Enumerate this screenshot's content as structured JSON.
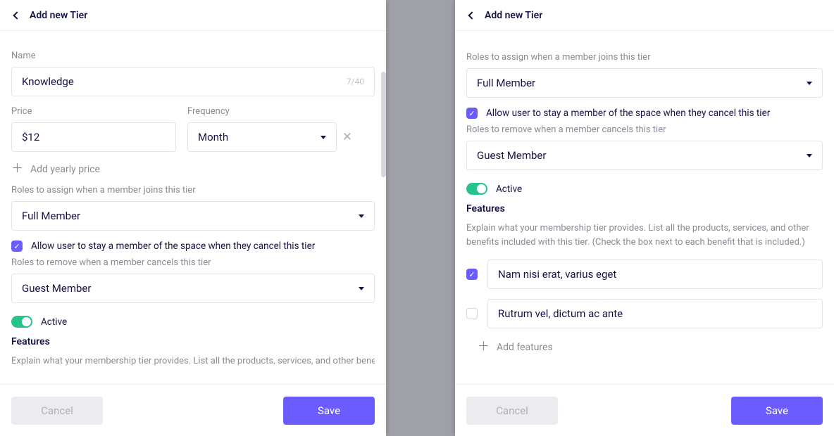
{
  "left": {
    "header": {
      "title": "Add new Tier"
    },
    "name_label": "Name",
    "name_value": "Knowledge",
    "name_counter": "7/40",
    "price_label": "Price",
    "price_value": "$12",
    "freq_label": "Frequency",
    "freq_value": "Month",
    "add_yearly": "Add yearly price",
    "roles_assign_label": "Roles to assign when a member joins this tier",
    "roles_assign_value": "Full Member",
    "allow_stay_label": "Allow user to stay a member of the space when they cancel this tier",
    "roles_remove_label": "Roles to remove when a member cancels this tier",
    "roles_remove_value": "Guest Member",
    "active_label": "Active",
    "features_title": "Features",
    "features_desc_cut": "Explain what your membership tier provides. List all the products, services, and other benefits",
    "cancel": "Cancel",
    "save": "Save"
  },
  "right": {
    "header": {
      "title": "Add new Tier"
    },
    "roles_assign_label": "Roles to assign when a member joins this tier",
    "roles_assign_value": "Full Member",
    "allow_stay_label": "Allow user to stay a member of the space when they cancel this tier",
    "roles_remove_label": "Roles to remove when a member cancels this tier",
    "roles_remove_value": "Guest Member",
    "active_label": "Active",
    "features_title": "Features",
    "features_desc": "Explain what your membership tier provides. List all the products, services, and other benefits included with this tier. (Check the box next to each benefit that is included.)",
    "feature1": "Nam nisi erat, varius eget",
    "feature2": "Rutrum vel, dictum ac ante",
    "add_features": "Add features",
    "cancel": "Cancel",
    "save": "Save"
  }
}
